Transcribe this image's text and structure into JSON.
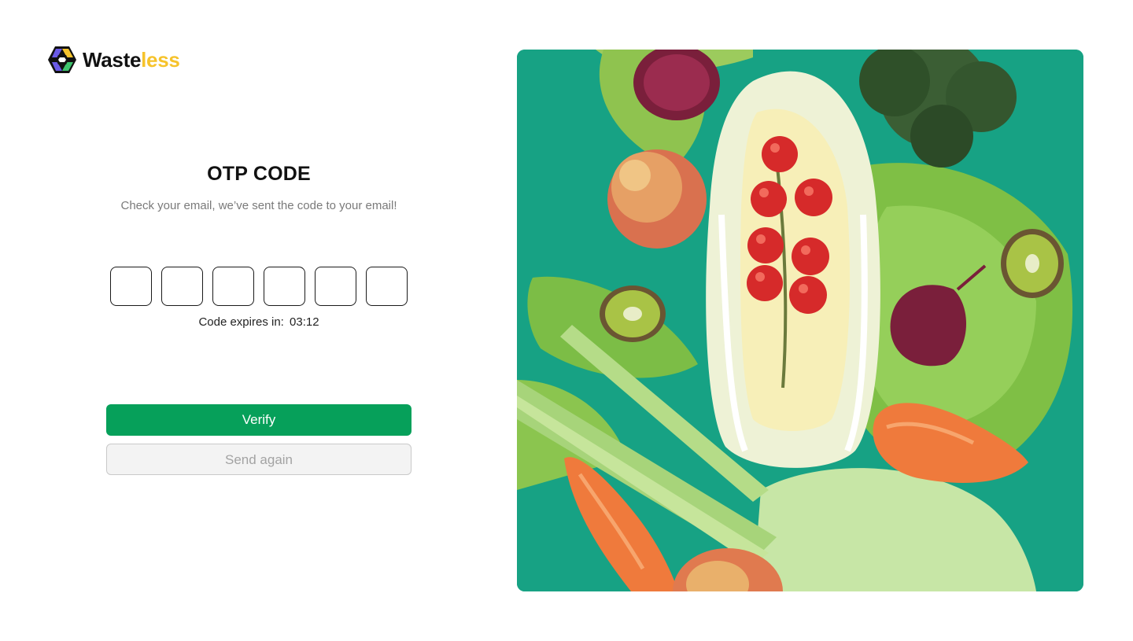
{
  "brand": {
    "name_part1": "Waste",
    "name_part2": "less",
    "accent_color": "#f6c32c",
    "icon": "hexagon-logo-icon"
  },
  "otp": {
    "title": "OTP CODE",
    "subtitle": "Check your email, we’ve sent the code to your email!",
    "digits": [
      "",
      "",
      "",
      "",
      "",
      ""
    ],
    "expiry_label": "Code expires in:",
    "expiry_time": "03:12"
  },
  "actions": {
    "verify_label": "Verify",
    "send_again_label": "Send again"
  },
  "colors": {
    "primary_green": "#06a05a",
    "hero_background": "#17a284"
  },
  "hero": {
    "subject": "vegetables-photo"
  }
}
